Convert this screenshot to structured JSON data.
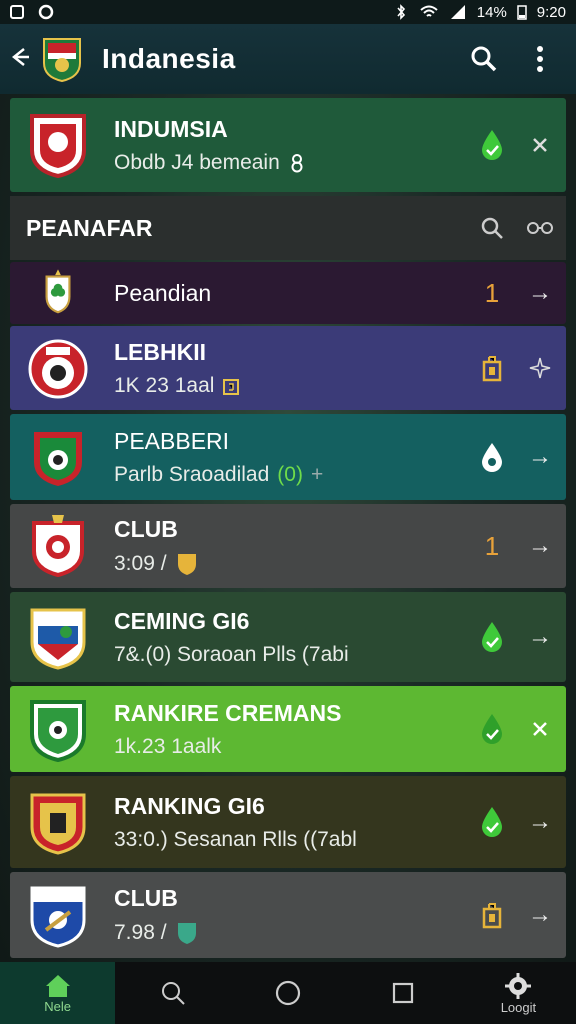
{
  "status_bar": {
    "battery": "14%",
    "time": "9:20"
  },
  "app_bar": {
    "title": "Indanesia"
  },
  "top_card": {
    "title": "INDUMSIA",
    "subtitle": "Obdb J4 bemeain"
  },
  "section": {
    "title": "PEANAFAR"
  },
  "rows": [
    {
      "title": "Peandian",
      "subtitle": "",
      "rank": "1"
    },
    {
      "title": "LEBHKII",
      "subtitle": "1K 23 1aal"
    },
    {
      "title": "PEABBERI",
      "subtitle": "Parlb Sraoadilad",
      "badge": "(0)"
    },
    {
      "title": "CLUB",
      "subtitle": "3:09 /",
      "rank": "1"
    },
    {
      "title": "CEMING GI6",
      "subtitle": "7&.(0) Soraoan Plls (7abi"
    },
    {
      "title": "RANKIRE CREMANS",
      "subtitle": "1k.23 1aalk"
    },
    {
      "title": "RANKING GI6",
      "subtitle": "33:0.) Sesanan Rlls ((7abl"
    },
    {
      "title": "CLUB",
      "subtitle": "7.98 /"
    }
  ],
  "bottom_nav": {
    "home_label": "Nele",
    "login_label": "Loogit"
  },
  "colors": {
    "accent_green": "#5db832",
    "check_green": "#3fc93a",
    "rank_orange": "#e8a23a"
  }
}
